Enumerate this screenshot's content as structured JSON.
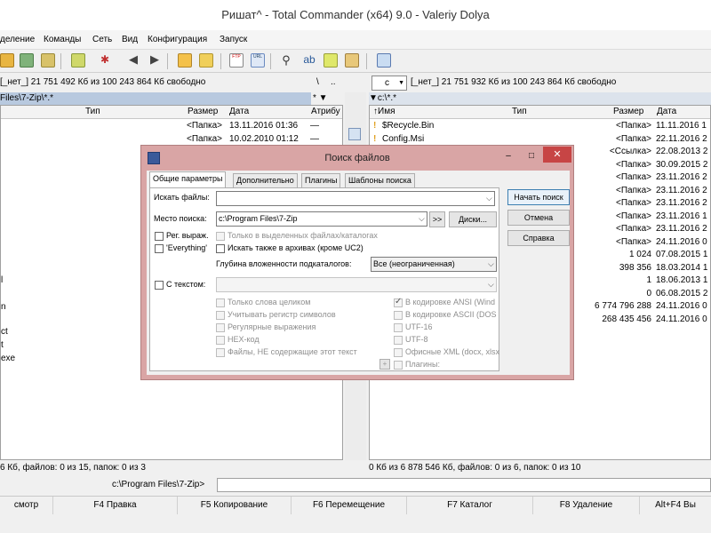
{
  "window": {
    "title": "Ришат^ - Total Commander (x64) 9.0 - Valeriy Dolya"
  },
  "menu": [
    "деление",
    "Команды",
    "Сеть",
    "Вид",
    "Конфигурация",
    "Запуск"
  ],
  "left_panel": {
    "drive_info": "[_нет_]  21 751 492 Кб из 100 243 864 Кб свободно",
    "root_btn": "\\",
    "up_btn": "..",
    "path": "Files\\7-Zip\\*.*",
    "path_right": "*  ▼",
    "headers": {
      "type": "Тип",
      "size": "Размер",
      "date": "Дата",
      "attr": "Атрибу"
    },
    "rows": [
      {
        "name": "",
        "size": "<Папка>",
        "date": "13.11.2016 01:36",
        "attr": "—"
      },
      {
        "name": "",
        "size": "<Папка>",
        "date": "10.02.2010 01:12",
        "attr": "—"
      }
    ],
    "name_fragments": [
      "l",
      "n",
      "ct",
      "t",
      "exe"
    ],
    "status": "6 Кб, файлов: 0 из 15, папок: 0 из 3"
  },
  "right_panel": {
    "drive": "c",
    "drive_info": "[_нет_]  21 751 932 Кб из 100 243 864 Кб свободно",
    "path": "▼c:\\*.*",
    "headers": {
      "name": "↑Имя",
      "type": "Тип",
      "size": "Размер",
      "date": "Дата"
    },
    "rows": [
      {
        "name": "$Recycle.Bin",
        "size": "<Папка>",
        "date": "11.11.2016 1"
      },
      {
        "name": "Config.Msi",
        "size": "<Папка>",
        "date": "22.11.2016 2"
      },
      {
        "name": "",
        "size": "<Ссылка>",
        "date": "22.08.2013 2"
      },
      {
        "name": "",
        "size": "<Папка>",
        "date": "30.09.2015 2"
      },
      {
        "name": "",
        "size": "<Папка>",
        "date": "23.11.2016 2"
      },
      {
        "name": "",
        "size": "<Папка>",
        "date": "23.11.2016 2"
      },
      {
        "name": "",
        "size": "<Папка>",
        "date": "23.11.2016 2"
      },
      {
        "name": "",
        "size": "<Папка>",
        "date": "23.11.2016 1"
      },
      {
        "name": "",
        "size": "<Папка>",
        "date": "23.11.2016 2"
      },
      {
        "name": "",
        "size": "<Папка>",
        "date": "24.11.2016 0"
      },
      {
        "name": "",
        "size": "1 024",
        "date": "07.08.2015 1"
      },
      {
        "name": "",
        "size": "398 356",
        "date": "18.03.2014 1"
      },
      {
        "name": "",
        "size": "1",
        "date": "18.06.2013 1"
      },
      {
        "name": "",
        "size": "0",
        "date": "06.08.2015 2"
      },
      {
        "name": "",
        "size": "6 774 796 288",
        "date": "24.11.2016 0"
      },
      {
        "name": "",
        "size": "268 435 456",
        "date": "24.11.2016 0"
      }
    ],
    "status": "0 Кб из 6 878 546 Кб, файлов: 0 из 6, папок: 0 из 10"
  },
  "command_line": {
    "prompt": "c:\\Program Files\\7-Zip>"
  },
  "fkeys": [
    "смотр",
    "F4 Правка",
    "F5 Копирование",
    "F6 Перемещение",
    "F7 Каталог",
    "F8 Удаление",
    "Alt+F4 Вы"
  ],
  "dialog": {
    "title": "Поиск файлов",
    "tabs": [
      "Общие параметры",
      "Дополнительно",
      "Плагины",
      "Шаблоны поиска"
    ],
    "search_label": "Искать файлы:",
    "search_value": "",
    "place_label": "Место поиска:",
    "place_value": "c:\\Program Files\\7-Zip",
    "arrows_btn": ">>",
    "disks_btn": "Диски...",
    "regex_label": "Рег. выраж.",
    "only_selected_label": "Только в выделенных файлах/каталогах",
    "everything_label": "'Everything'",
    "archives_label": "Искать также в архивах (кроме UC2)",
    "depth_label": "Глубина вложенности подкаталогов:",
    "depth_value": "Все (неограниченная)",
    "with_text_label": "С текстом:",
    "text_value": "",
    "options_left": [
      "Только слова целиком",
      "Учитывать регистр символов",
      "Регулярные выражения",
      "HEX-код",
      "Файлы, НЕ содержащие этот текст"
    ],
    "options_right": [
      "В кодировке ANSI (Wind",
      "В кодировке ASCII (DOS",
      "UTF-16",
      "UTF-8",
      "Офисные XML (docx, xlsx",
      "Плагины:"
    ],
    "plus_btn": "+",
    "buttons": {
      "start": "Начать поиск",
      "cancel": "Отмена",
      "help": "Справка"
    }
  }
}
